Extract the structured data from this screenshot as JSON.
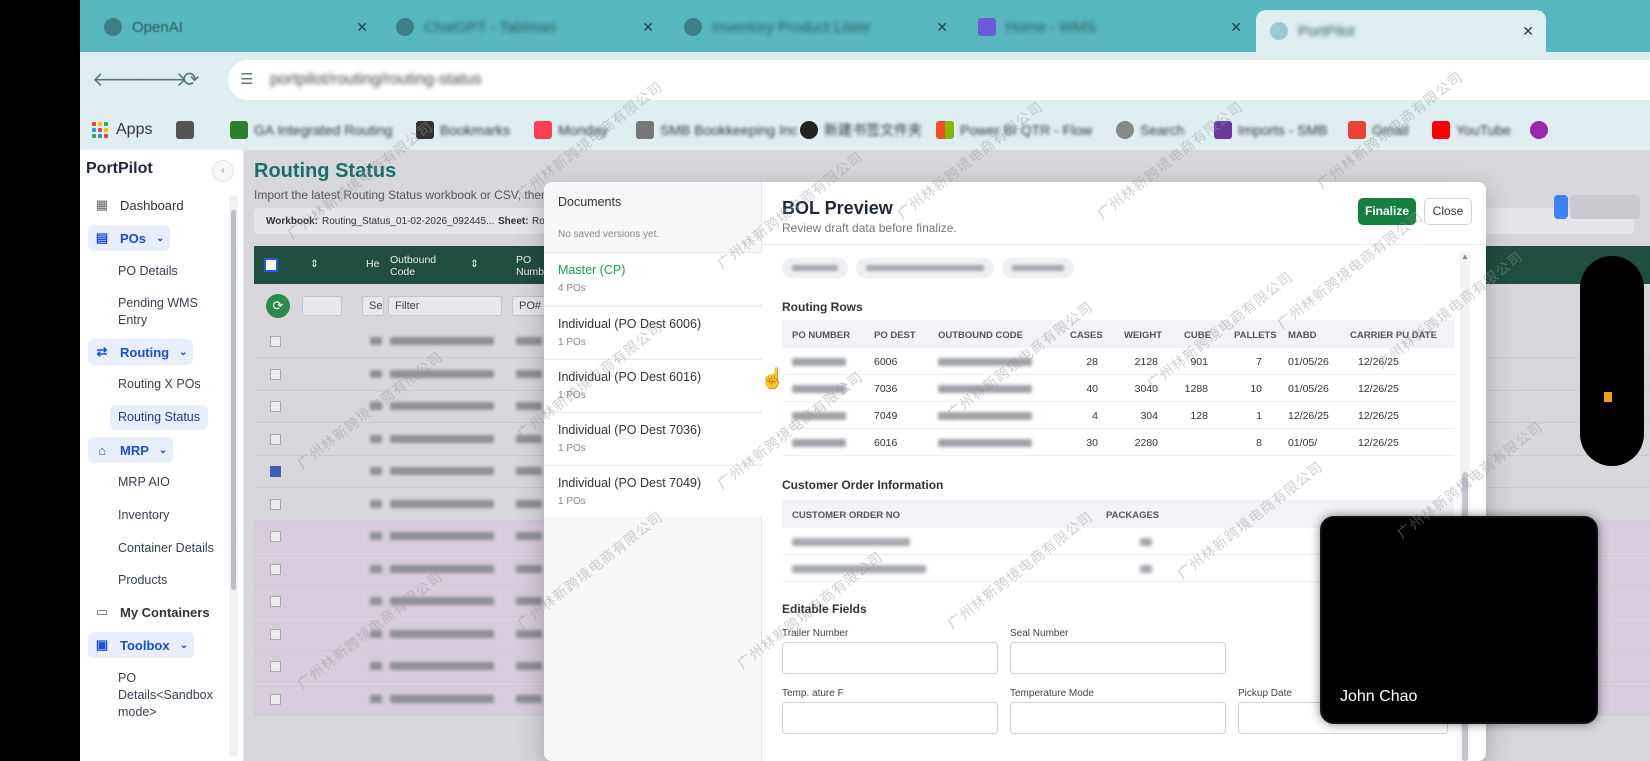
{
  "browser": {
    "tabs": [
      {
        "title": "OpenAI"
      },
      {
        "title": "ChatGPT - Tablman"
      },
      {
        "title": "Inventory Product Lister"
      },
      {
        "title": "Home - WMS"
      },
      {
        "title": "PortPilot"
      }
    ],
    "url": "portpilot/routing/routing-status",
    "bookmarks": [
      {
        "label": "Apps"
      },
      {
        "label": "GA Integrated Routing"
      },
      {
        "label": "Bookmarks"
      },
      {
        "label": "Monday"
      },
      {
        "label": "SMB Bookkeeping Inc"
      },
      {
        "label": "新建书签文件夹"
      },
      {
        "label": "Power BI QTR - Flow"
      },
      {
        "label": "Search"
      },
      {
        "label": "Imports - SMB"
      },
      {
        "label": "Gmail"
      },
      {
        "label": "YouTube"
      }
    ]
  },
  "sidebar": {
    "brand": "PortPilot",
    "items": [
      {
        "label": "Dashboard",
        "icon": "grid-icon"
      },
      {
        "label": "POs",
        "icon": "clipboard-icon"
      },
      {
        "label": "PO Details"
      },
      {
        "label": "Pending WMS Entry"
      },
      {
        "label": "Routing",
        "icon": "routing-icon"
      },
      {
        "label": "Routing X POs"
      },
      {
        "label": "Routing Status"
      },
      {
        "label": "MRP",
        "icon": "factory-icon"
      },
      {
        "label": "MRP AIO"
      },
      {
        "label": "Inventory"
      },
      {
        "label": "Container Details"
      },
      {
        "label": "Products"
      },
      {
        "label": "My Containers",
        "icon": "container-icon"
      },
      {
        "label": "Toolbox",
        "icon": "toolbox-icon"
      },
      {
        "label": "PO Details<Sandbox mode>"
      }
    ]
  },
  "page": {
    "title": "Routing Status",
    "subtitle": "Import the latest Routing Status workbook or CSV, then fil",
    "workbook_label": "Workbook:",
    "workbook_value": "Routing_Status_01-02-2026_092445...",
    "sheet_label": "Sheet:",
    "sheet_value": "Ro",
    "grid_headers": [
      "He",
      "Outbound Code",
      "PO Numb"
    ],
    "filter_placeholder": "Filter",
    "filter_short": "Se",
    "po_filter": "PO#"
  },
  "modal": {
    "documents": {
      "title": "Documents",
      "empty": "No saved versions yet.",
      "items": [
        {
          "name": "Master (CP)",
          "count": "4 POs"
        },
        {
          "name": "Individual (PO Dest 6006)",
          "count": "1 POs"
        },
        {
          "name": "Individual (PO Dest 6016)",
          "count": "1 POs"
        },
        {
          "name": "Individual (PO Dest 7036)",
          "count": "1 POs"
        },
        {
          "name": "Individual (PO Dest 7049)",
          "count": "1 POs"
        }
      ]
    },
    "bol": {
      "title": "BOL Preview",
      "subtitle": "Review draft data before finalize.",
      "finalize": "Finalize",
      "close": "Close",
      "routing_rows_title": "Routing Rows",
      "routing_headers": [
        "PO NUMBER",
        "PO DEST",
        "OUTBOUND CODE",
        "CASES",
        "WEIGHT",
        "CUBE",
        "PALLETS",
        "MABD",
        "CARRIER PU DATE"
      ],
      "routing_rows": [
        {
          "dest": "6006",
          "cases": "28",
          "weight": "2128",
          "cube": "901",
          "pallets": "7",
          "mabd": "01/05/26",
          "pu": "12/26/25"
        },
        {
          "dest": "7036",
          "cases": "40",
          "weight": "3040",
          "cube": "1288",
          "pallets": "10",
          "mabd": "01/05/26",
          "pu": "12/26/25"
        },
        {
          "dest": "7049",
          "cases": "4",
          "weight": "304",
          "cube": "128",
          "pallets": "1",
          "mabd": "12/26/25",
          "pu": "12/26/25"
        },
        {
          "dest": "6016",
          "cases": "30",
          "weight": "2280",
          "cube": "",
          "pallets": "8",
          "mabd": "01/05/",
          "pu": "12/26/25"
        }
      ],
      "customer_title": "Customer Order Information",
      "customer_headers": [
        "CUSTOMER ORDER NO",
        "PACKAGES"
      ],
      "editable_title": "Editable Fields",
      "fields": {
        "trailer": "Trailer Number",
        "seal": "Seal Number",
        "temperature": "Temp. ature F",
        "temp_mode": "Temperature Mode",
        "pickup": "Pickup Date"
      }
    }
  },
  "video": {
    "name": "John Chao"
  },
  "watermark": "广州林新跨境电商有限公司"
}
